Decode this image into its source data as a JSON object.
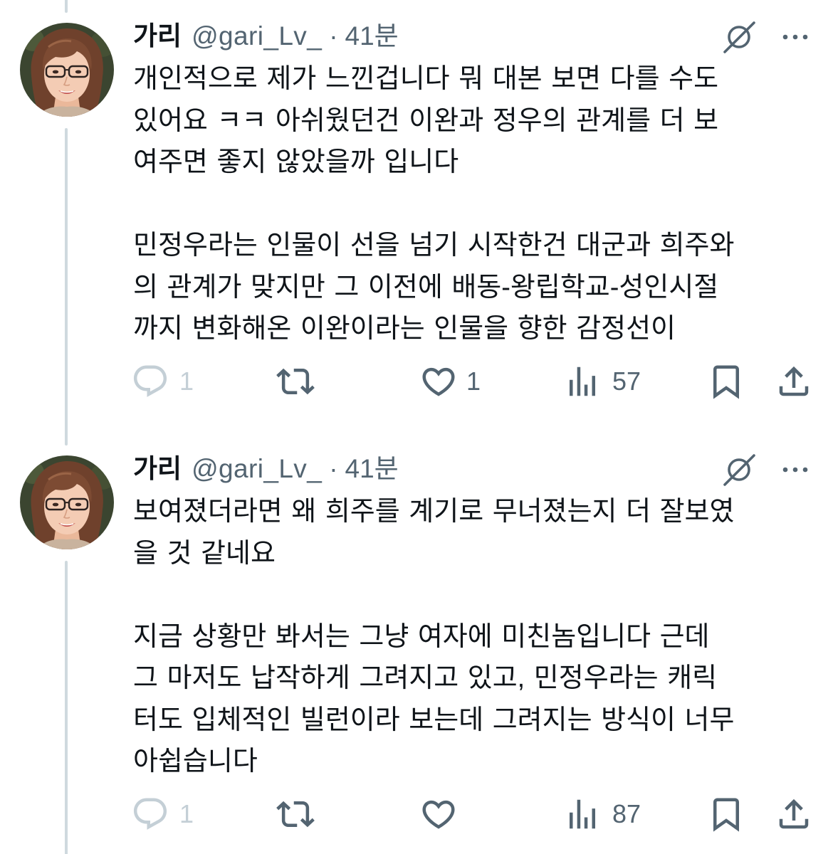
{
  "colors": {
    "background": "#ffffff",
    "text": "#0f1419",
    "secondary": "#536471",
    "muted": "#c4cfd6",
    "thread_line": "#cfd9de"
  },
  "icons": {
    "header": [
      "grok-icon",
      "more-icon"
    ],
    "actions": [
      "reply-icon",
      "repost-icon",
      "like-icon",
      "views-icon",
      "bookmark-icon",
      "share-icon"
    ]
  },
  "tweets": [
    {
      "author": {
        "name": "가리",
        "handle": "@gari_Lv_",
        "separator": "·",
        "time": "41분"
      },
      "paragraphs": [
        [
          "개인적으로 제가 느낀겁니다 뭐 대본 보면 다를 수도",
          "있어요 ㅋㅋ 아쉬웠던건 이완과 정우의 관계를 더 보",
          "여주면 좋지 않았을까 입니다"
        ],
        [
          "민정우라는 인물이 선을 넘기 시작한건 대군과 희주와",
          "의 관계가 맞지만 그 이전에 배동-왕립학교-성인시절",
          "까지 변화해온 이완이라는 인물을 향한 감정선이"
        ]
      ],
      "stats": {
        "replies": "1",
        "likes": "1",
        "views": "57"
      }
    },
    {
      "author": {
        "name": "가리",
        "handle": "@gari_Lv_",
        "separator": "·",
        "time": "41분"
      },
      "paragraphs": [
        [
          "보여졌더라면 왜 희주를 계기로 무너졌는지 더 잘보였",
          "을 것 같네요"
        ],
        [
          "지금 상황만 봐서는 그냥 여자에 미친놈입니다 근데",
          "그 마저도 납작하게 그려지고 있고, 민정우라는 캐릭",
          "터도 입체적인 빌런이라 보는데 그려지는 방식이 너무",
          "아쉽습니다"
        ]
      ],
      "stats": {
        "replies": "1",
        "views": "87"
      }
    }
  ]
}
